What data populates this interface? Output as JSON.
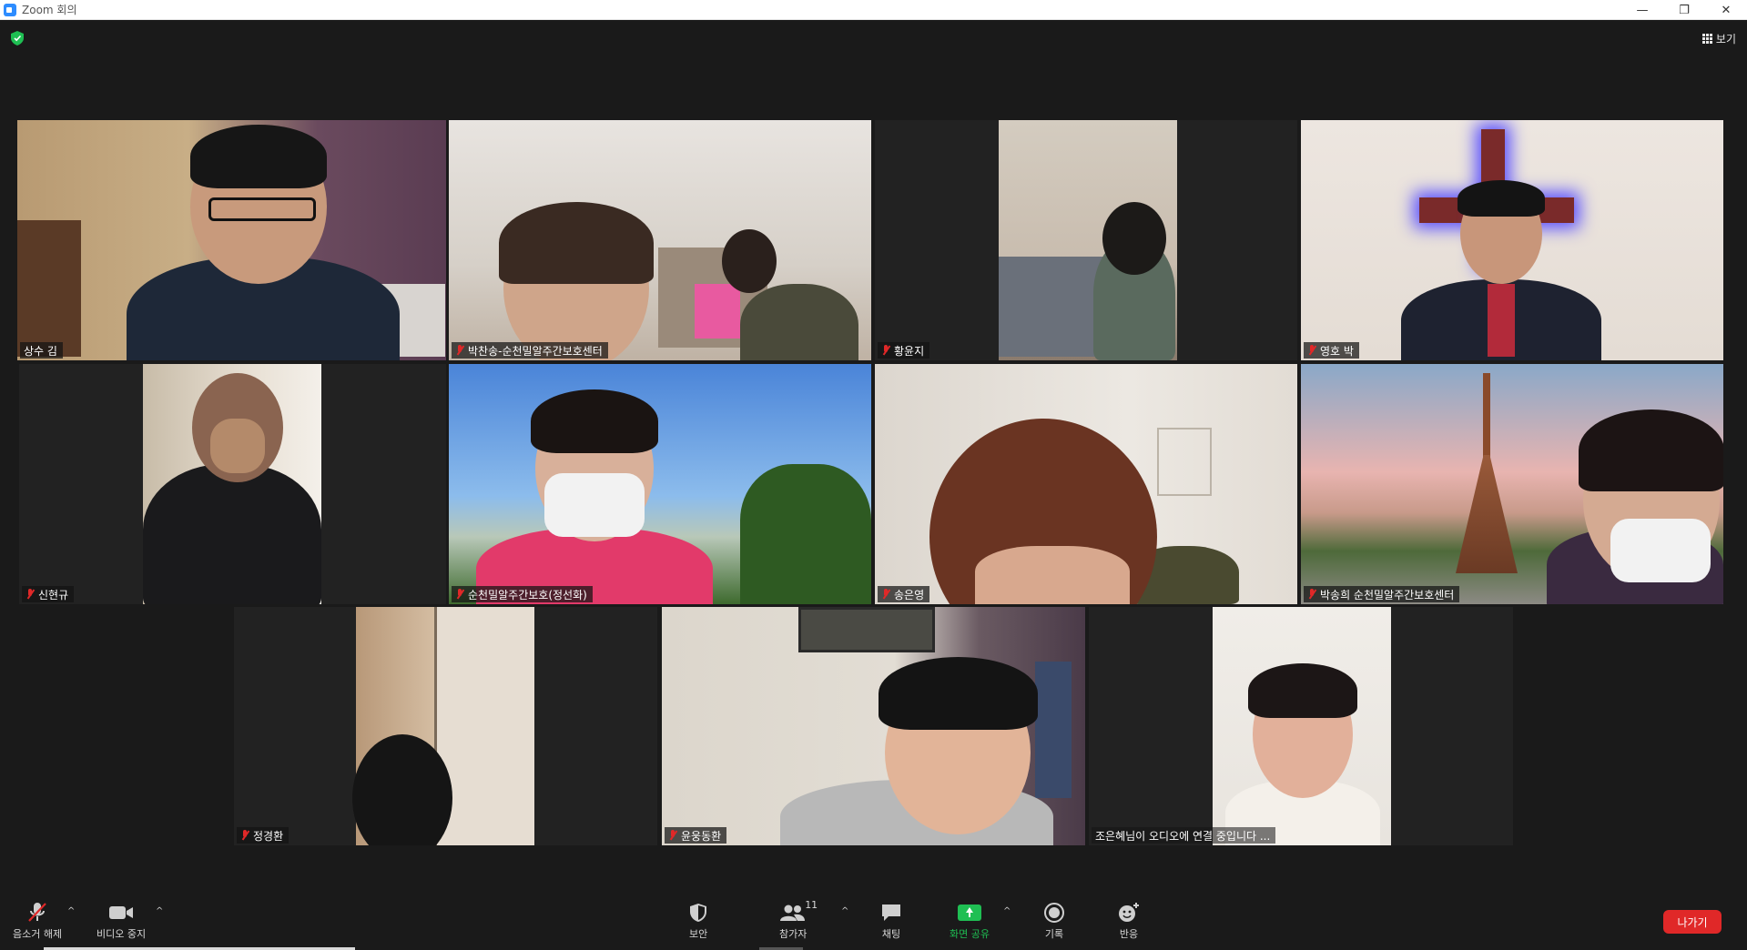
{
  "window": {
    "title": "Zoom 회의",
    "controls": [
      "minimize",
      "restore",
      "close"
    ]
  },
  "top": {
    "security_status": "encrypted",
    "view_label": "보기"
  },
  "participants": [
    {
      "name": "상수 김",
      "muted": false,
      "active_speaker": true
    },
    {
      "name": "박찬송-순천밀알주간보호센터",
      "muted": true
    },
    {
      "name": "황윤지",
      "muted": true
    },
    {
      "name": "영호 박",
      "muted": true
    },
    {
      "name": "신현규",
      "muted": true
    },
    {
      "name": "순천밀알주간보호(정선화)",
      "muted": true
    },
    {
      "name": "송은영",
      "muted": true
    },
    {
      "name": "박송희 순천밀알주간보호센터",
      "muted": true
    },
    {
      "name": "정경환",
      "muted": true
    },
    {
      "name": "윤웅동환",
      "muted": true
    },
    {
      "name": "조은혜님이 오디오에 연결 중입니다 ...",
      "muted": false
    }
  ],
  "toolbar": {
    "mute_label": "음소거 해제",
    "video_label": "비디오 중지",
    "security_label": "보안",
    "participants_label": "참가자",
    "participants_count": "11",
    "chat_label": "채팅",
    "share_label": "화면 공유",
    "record_label": "기록",
    "reactions_label": "반응",
    "leave_label": "나가기"
  },
  "colors": {
    "background": "#1a1a1a",
    "active_speaker_border": "#e6e65a",
    "share_green": "#1fbf53",
    "leave_red": "#e02828",
    "mute_red": "#e02828"
  }
}
